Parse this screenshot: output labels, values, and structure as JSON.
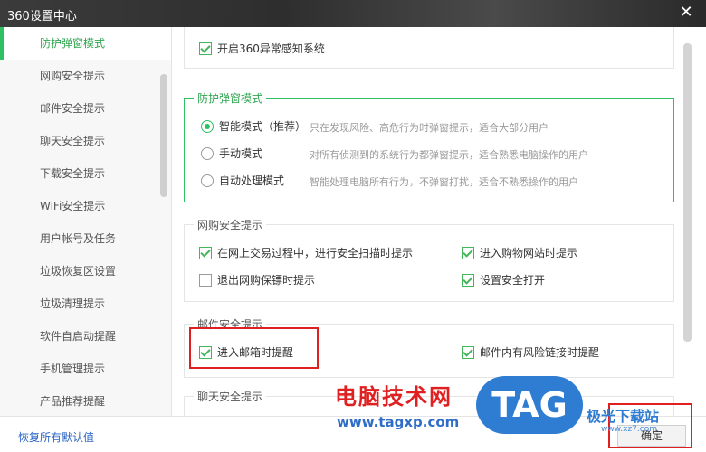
{
  "window": {
    "title": "360设置中心",
    "close_glyph": "✕"
  },
  "sidebar": {
    "items": [
      {
        "label": "防护弹窗模式",
        "active": true
      },
      {
        "label": "网购安全提示"
      },
      {
        "label": "邮件安全提示"
      },
      {
        "label": "聊天安全提示"
      },
      {
        "label": "下载安全提示"
      },
      {
        "label": "WiFi安全提示"
      },
      {
        "label": "用户帐号及任务"
      },
      {
        "label": "垃圾恢复区设置"
      },
      {
        "label": "垃圾清理提示"
      },
      {
        "label": "软件自启动提醒"
      },
      {
        "label": "手机管理提示"
      },
      {
        "label": "产品推荐提醒"
      }
    ]
  },
  "main": {
    "top_partial_title": "360异常感知系统",
    "top_checkbox": {
      "label": "开启360异常感知系统",
      "checked": true
    },
    "popup_mode": {
      "title": "防护弹窗模式",
      "options": [
        {
          "label": "智能模式（推荐）",
          "desc": "只在发现风险、高危行为时弹窗提示，适合大部分用户",
          "selected": true
        },
        {
          "label": "手动模式",
          "desc": "对所有侦测到的系统行为都弹窗提示，适合熟悉电脑操作的用户",
          "selected": false
        },
        {
          "label": "自动处理模式",
          "desc": "智能处理电脑所有行为，不弹窗打扰，适合不熟悉操作的用户",
          "selected": false
        }
      ]
    },
    "shopping": {
      "title": "网购安全提示",
      "items": [
        {
          "label": "在网上交易过程中，进行安全扫描时提示",
          "checked": true
        },
        {
          "label": "进入购物网站时提示",
          "checked": true
        },
        {
          "label": "退出网购保镖时提示",
          "checked": false
        },
        {
          "label": "设置安全打开",
          "checked": true
        }
      ]
    },
    "mail": {
      "title": "邮件安全提示",
      "items": [
        {
          "label": "进入邮箱时提醒",
          "checked": true
        },
        {
          "label": "邮件内有风险链接时提醒",
          "checked": true
        }
      ]
    },
    "chat": {
      "title": "聊天安全提示"
    }
  },
  "footer": {
    "restore_label": "恢复所有默认值",
    "ok_label": "确定"
  },
  "watermark": {
    "cn_text": "电脑技术网",
    "url": "www.tagxp.com",
    "tag_text": "TAG",
    "jg_text": "极光下载站",
    "jg_url": "www.xz7.com"
  },
  "colors": {
    "accent_green": "#2fc064",
    "highlight_red": "#e02020",
    "link_blue": "#2a64c5",
    "tag_blue": "#2f7dd3"
  }
}
